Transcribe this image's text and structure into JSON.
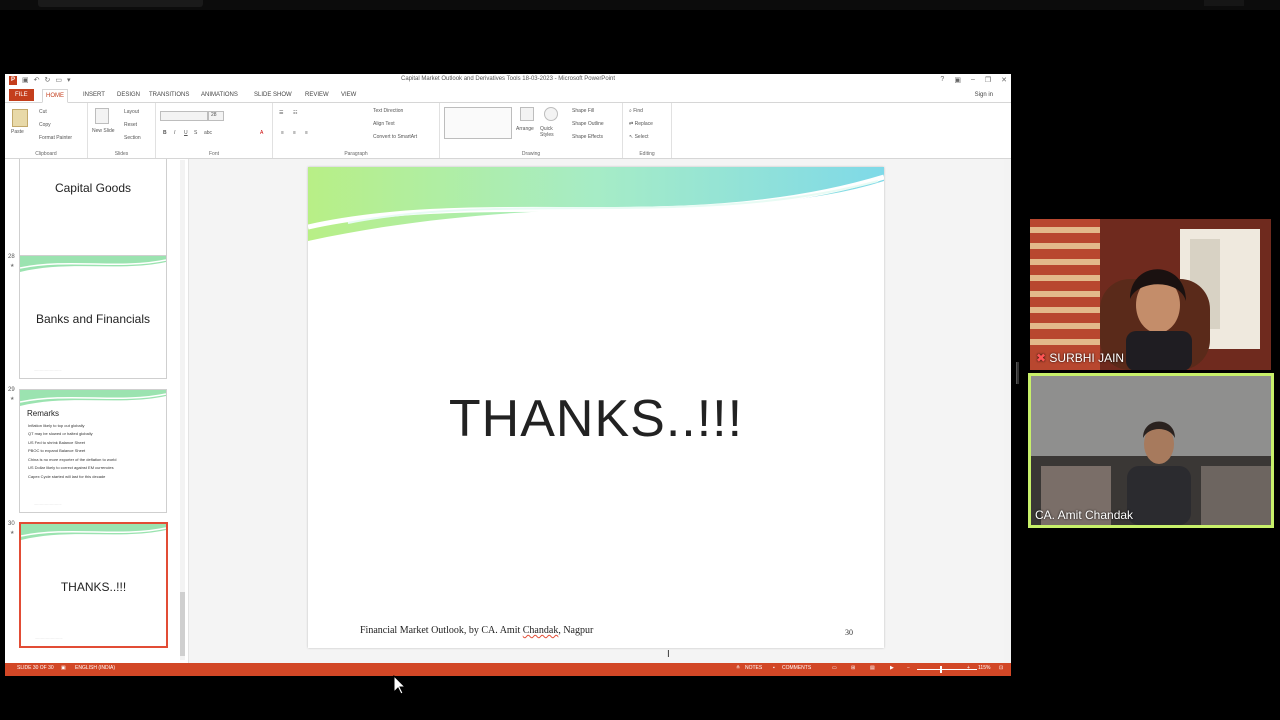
{
  "window": {
    "title": "Capital Market Outlook and Derivatives Tools 18-03-2023 - Microsoft PowerPoint",
    "signin": "Sign in"
  },
  "tabs": [
    "FILE",
    "HOME",
    "INSERT",
    "DESIGN",
    "TRANSITIONS",
    "ANIMATIONS",
    "SLIDE SHOW",
    "REVIEW",
    "VIEW"
  ],
  "ribbon": {
    "clipboard": {
      "label": "Clipboard",
      "paste": "Paste",
      "cut": "Cut",
      "copy": "Copy",
      "format_painter": "Format Painter"
    },
    "slides": {
      "label": "Slides",
      "new_slide": "New Slide",
      "layout": "Layout",
      "reset": "Reset",
      "section": "Section"
    },
    "font": {
      "label": "Font",
      "size": "28"
    },
    "paragraph": {
      "label": "Paragraph",
      "text_direction": "Text Direction",
      "align_text": "Align Text",
      "convert": "Convert to SmartArt"
    },
    "drawing": {
      "label": "Drawing",
      "arrange": "Arrange",
      "quick_styles": "Quick Styles",
      "shape_fill": "Shape Fill",
      "shape_outline": "Shape Outline",
      "shape_effects": "Shape Effects"
    },
    "editing": {
      "label": "Editing",
      "find": "Find",
      "replace": "Replace",
      "select": "Select"
    }
  },
  "thumbnails": {
    "t27": {
      "title": "Capital Goods"
    },
    "t28": {
      "num": "28",
      "title": "Banks and Financials"
    },
    "t29": {
      "num": "29",
      "title": "Remarks",
      "bullets": [
        "Inflation likely to top out globally",
        "QT may be slowed or halted globally",
        "US Fed to shrink Balance Sheet",
        "PBOC to expand Balance Sheet",
        "China is no more exporter of the deflation to world",
        "US Dollar likely to correct against EM currencies",
        "Capex Cycle started will last for this decade"
      ]
    },
    "t30": {
      "num": "30",
      "title": "THANKS..!!!"
    }
  },
  "slide": {
    "title": "THANKS..!!!",
    "footer_pre": "Financial Market Outlook, by CA. Amit ",
    "footer_name": "Chandak",
    "footer_post": ", Nagpur",
    "number": "30"
  },
  "status": {
    "slide_of": "SLIDE 30 OF 30",
    "language": "ENGLISH (INDIA)",
    "notes": "NOTES",
    "comments": "COMMENTS",
    "zoom": "115%"
  },
  "participants": [
    {
      "name": "SURBHI JAIN"
    },
    {
      "name": "CA. Amit Chandak"
    }
  ],
  "colors": {
    "accent": "#d24726",
    "active_speaker": "#c8f06a"
  }
}
